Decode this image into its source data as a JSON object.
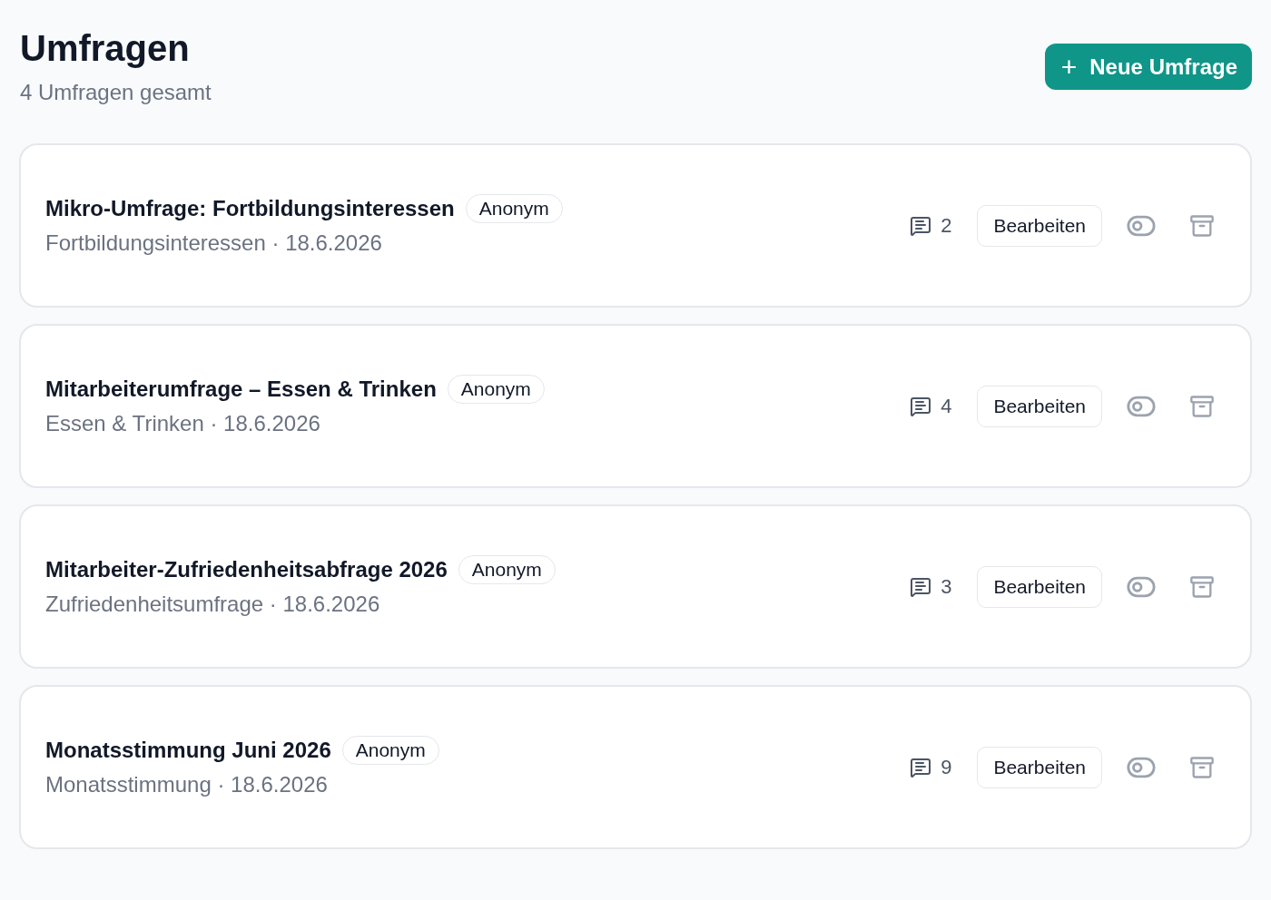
{
  "header": {
    "title": "Umfragen",
    "subtitle": "4 Umfragen gesamt",
    "new_button": {
      "icon": "+",
      "label": "Neue Umfrage"
    }
  },
  "surveys": [
    {
      "title": "Mikro-Umfrage: Fortbildungsinteressen",
      "badge": "Anonym",
      "meta": "Fortbildungsinteressen · 18.6.2026",
      "responses": "2",
      "edit_label": "Bearbeiten",
      "active": false
    },
    {
      "title": "Mitarbeiterumfrage – Essen & Trinken",
      "badge": "Anonym",
      "meta": "Essen & Trinken · 18.6.2026",
      "responses": "4",
      "edit_label": "Bearbeiten",
      "active": false
    },
    {
      "title": "Mitarbeiter-Zufriedenheitsabfrage 2026",
      "badge": "Anonym",
      "meta": "Zufriedenheitsumfrage · 18.6.2026",
      "responses": "3",
      "edit_label": "Bearbeiten",
      "active": false
    },
    {
      "title": "Monatsstimmung Juni 2026",
      "badge": "Anonym",
      "meta": "Monatsstimmung · 18.6.2026",
      "responses": "9",
      "edit_label": "Bearbeiten",
      "active": false
    }
  ]
}
